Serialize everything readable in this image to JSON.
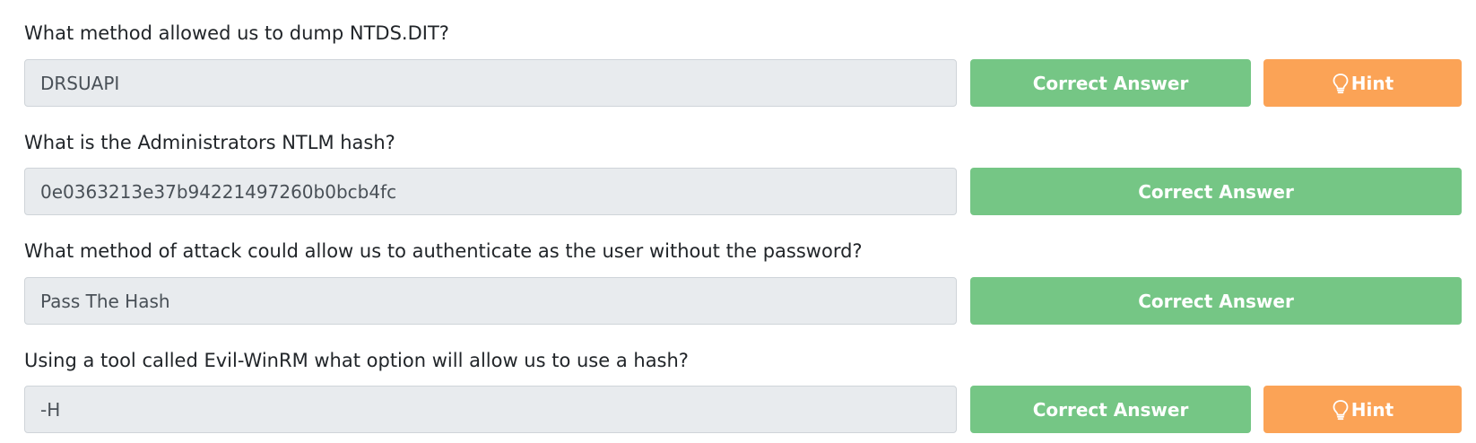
{
  "questions": [
    {
      "text": "What method allowed us to dump NTDS.DIT?",
      "answer": "DRSUAPI",
      "submit_label": "Correct Answer",
      "hint_label": "Hint"
    },
    {
      "text": "What is the Administrators NTLM hash?",
      "answer": "0e0363213e37b94221497260b0bcb4fc",
      "submit_label": "Correct Answer"
    },
    {
      "text": "What method of attack could allow us to authenticate as the user without the password?",
      "answer": "Pass The Hash",
      "submit_label": "Correct Answer"
    },
    {
      "text": "Using a tool called Evil-WinRM what option will allow us to use a hash?",
      "answer": "-H",
      "submit_label": "Correct Answer",
      "hint_label": "Hint"
    }
  ],
  "icons": {
    "hint": "lightbulb-icon"
  },
  "colors": {
    "correct": "#75c685",
    "hint": "#fba356",
    "input_bg": "#e8ebee"
  }
}
